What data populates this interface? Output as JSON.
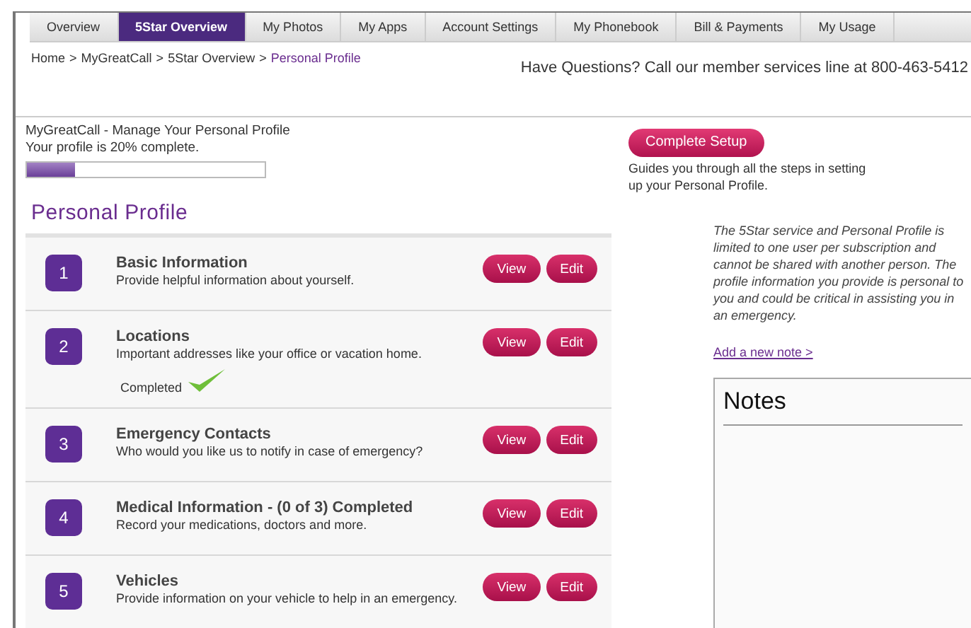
{
  "tabs": [
    {
      "label": "Overview",
      "selected": false
    },
    {
      "label": "5Star Overview",
      "selected": true
    },
    {
      "label": "My Photos",
      "selected": false
    },
    {
      "label": "My Apps",
      "selected": false
    },
    {
      "label": "Account Settings",
      "selected": false
    },
    {
      "label": "My Phonebook",
      "selected": false
    },
    {
      "label": "Bill & Payments",
      "selected": false
    },
    {
      "label": "My Usage",
      "selected": false
    }
  ],
  "breadcrumb": [
    {
      "label": "Home",
      "current": false
    },
    {
      "label": "MyGreatCall",
      "current": false
    },
    {
      "label": "5Star Overview",
      "current": false
    },
    {
      "label": "Personal Profile",
      "current": true
    }
  ],
  "breadcrumb_separator": ">",
  "help_line": "Have Questions? Call our member services line at 800-463-5412",
  "profile_status": {
    "title": "MyGreatCall - Manage Your Personal Profile",
    "text": "Your profile is 20% complete.",
    "level": 0.2
  },
  "setup": {
    "button": "Complete Setup",
    "description": "Guides you through all the steps in setting up your Personal Profile."
  },
  "section_title": "Personal Profile",
  "steps": [
    {
      "number": "1",
      "title": "Basic Information",
      "description": "Provide helpful information about yourself.",
      "completed": false,
      "view": "View",
      "edit": "Edit"
    },
    {
      "number": "2",
      "title": "Locations",
      "description": "Important addresses like your office or vacation home.",
      "completed": true,
      "view": "View",
      "edit": "Edit"
    },
    {
      "number": "3",
      "title": "Emergency Contacts",
      "description": "Who would you like us to notify in case of emergency?",
      "completed": false,
      "view": "View",
      "edit": "Edit"
    },
    {
      "number": "4",
      "title": "Medical Information - (0 of 3) Completed",
      "description": "Record your medications, doctors and more.",
      "completed": false,
      "view": "View",
      "edit": "Edit"
    },
    {
      "number": "5",
      "title": "Vehicles",
      "description": "Provide information on your vehicle to help in an emergency.",
      "completed": false,
      "view": "View",
      "edit": "Edit"
    }
  ],
  "completed_label": "Completed",
  "sidebar": {
    "notice": "The 5Star service and Personal Profile is limited to one user per subscription and cannot be shared with another person. The profile information you provide is personal to you and could be critical in assisting you in an emergency.",
    "link": "Add a new note >",
    "notes_title": "Notes"
  }
}
